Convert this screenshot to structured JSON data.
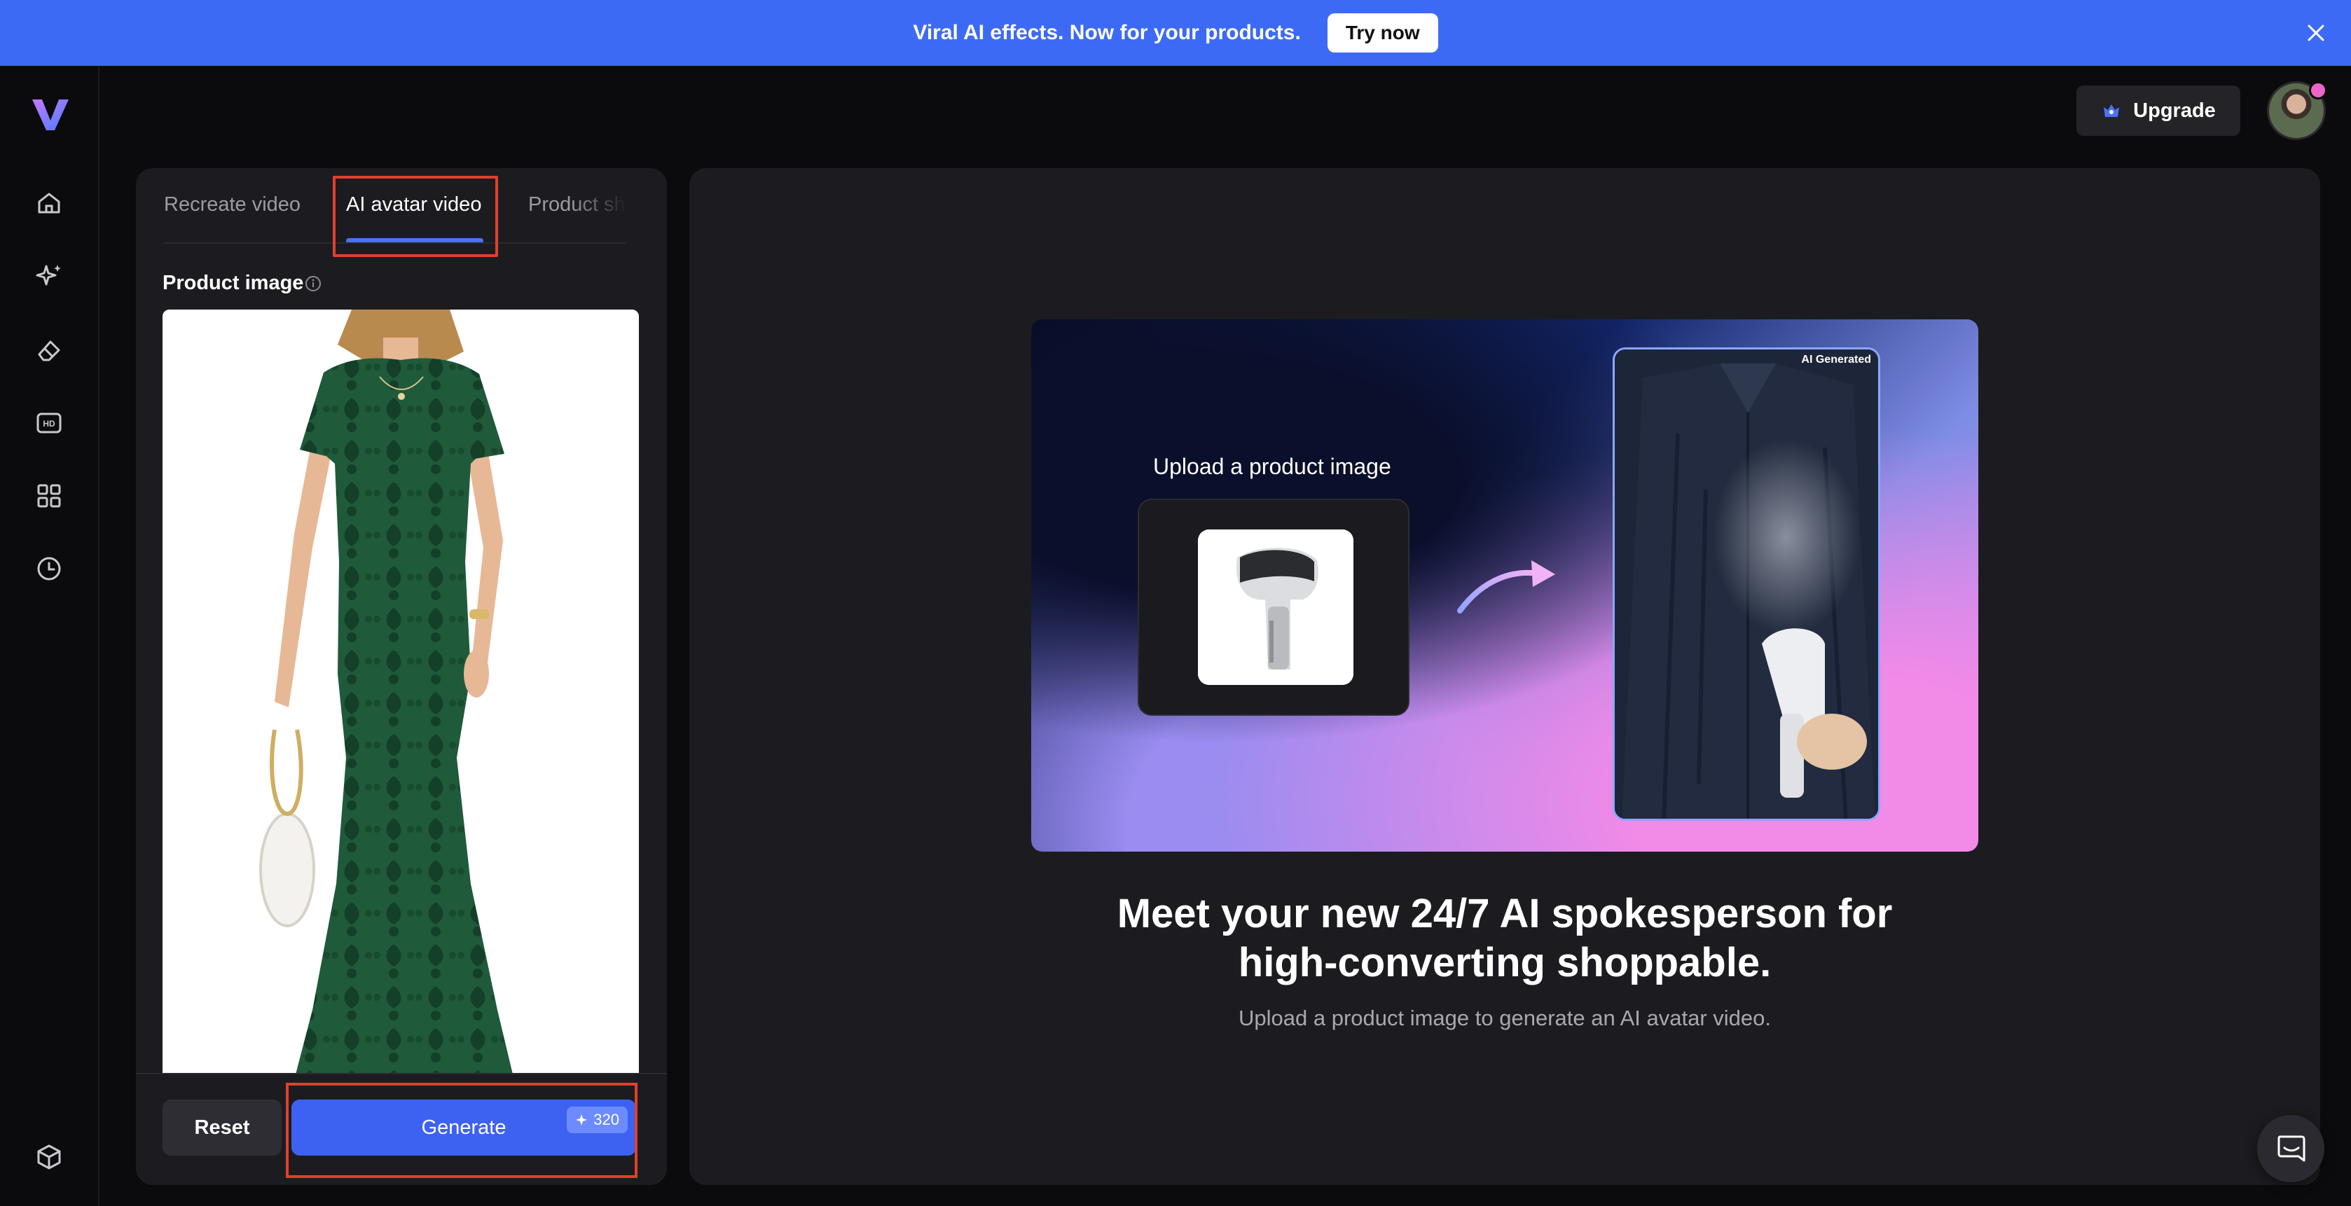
{
  "banner": {
    "text": "Viral AI effects. Now for your products.",
    "cta_label": "Try now",
    "close_icon": "close-icon",
    "background": "#3d6af5"
  },
  "sidebar": {
    "logo": "V",
    "items": [
      {
        "icon": "home-icon"
      },
      {
        "icon": "magic-sparkle-icon"
      },
      {
        "icon": "eraser-icon"
      },
      {
        "icon": "hd-icon"
      },
      {
        "icon": "apps-grid-icon"
      },
      {
        "icon": "history-clock-icon"
      }
    ],
    "bottom_icon": "box-icon"
  },
  "topbar": {
    "upgrade_label": "Upgrade",
    "upgrade_icon": "crown-icon"
  },
  "left_panel": {
    "tabs": [
      {
        "label": "Recreate video",
        "active": false
      },
      {
        "label": "AI avatar video",
        "active": true
      },
      {
        "label": "Product sho",
        "active": false
      }
    ],
    "product_image_label": "Product image",
    "reset_label": "Reset",
    "generate_label": "Generate",
    "credits": "320"
  },
  "hero": {
    "upload_title": "Upload a product image",
    "ai_badge": "AI Generated"
  },
  "content": {
    "headline_line1": "Meet your new 24/7 AI spokesperson for",
    "headline_line2": "high-converting shoppable.",
    "subtitle": "Upload a product image to generate an AI avatar video."
  },
  "colors": {
    "accent": "#3d62f2",
    "highlight": "#e0402e",
    "panel": "#1c1c20"
  }
}
